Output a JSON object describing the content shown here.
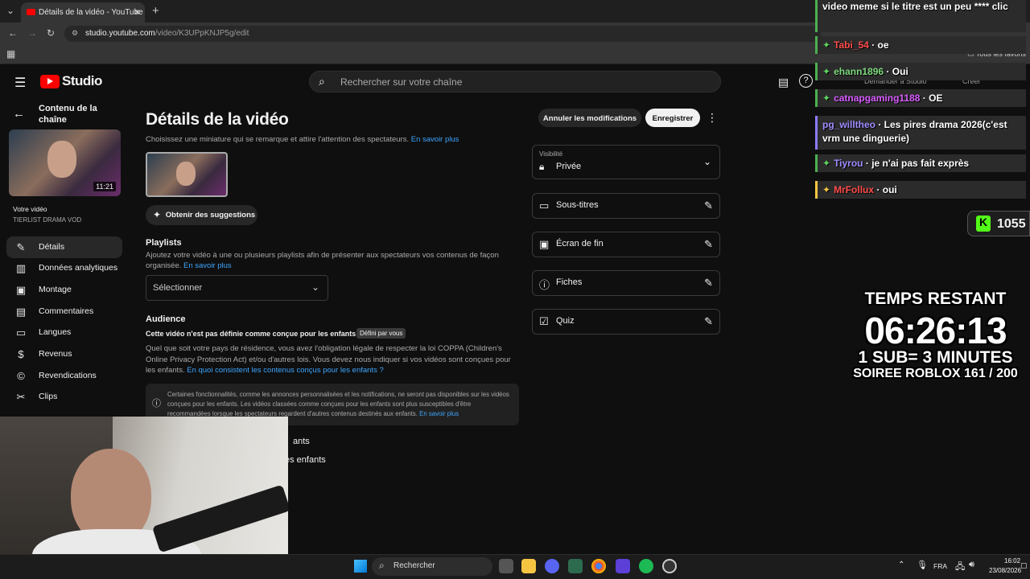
{
  "browser": {
    "tab_title": "Détails de la vidéo - YouTube Studio",
    "url_host": "studio.youtube.com",
    "url_path": "/video/K3UPpKNJP5g/edit",
    "bookmarks_label": "Tous les favoris"
  },
  "header": {
    "logo_text": "Studio",
    "search_placeholder": "Rechercher sur votre chaîne",
    "studio_ask": "Demander à Studio",
    "create": "Créer"
  },
  "sidebar": {
    "back_label": "Contenu de la chaîne",
    "video_duration": "11:21",
    "your_video": "Votre vidéo",
    "video_name": "TIERLIST DRAMA VOD",
    "items": [
      {
        "label": "Détails",
        "icon": "pencil-icon"
      },
      {
        "label": "Données analytiques",
        "icon": "analytics-icon"
      },
      {
        "label": "Montage",
        "icon": "editor-icon"
      },
      {
        "label": "Commentaires",
        "icon": "comments-icon"
      },
      {
        "label": "Langues",
        "icon": "subtitles-icon"
      },
      {
        "label": "Revenus",
        "icon": "dollar-icon"
      },
      {
        "label": "Revendications",
        "icon": "copyright-icon"
      },
      {
        "label": "Clips",
        "icon": "scissors-icon"
      }
    ]
  },
  "main": {
    "title": "Détails de la vidéo",
    "thumbnail_help": "Choisissez une miniature qui se remarque et attire l'attention des spectateurs.",
    "learn_more": "En savoir plus",
    "suggestions_button": "Obtenir des suggestions",
    "cancel_button": "Annuler les modifications",
    "save_button": "Enregistrer",
    "playlists": {
      "heading": "Playlists",
      "help": "Ajoutez votre vidéo à une ou plusieurs playlists afin de présenter aux spectateurs vos contenus de façon organisée.",
      "select_label": "Sélectionner"
    },
    "audience": {
      "heading": "Audience",
      "status": "Cette vidéo n'est pas définie comme conçue pour les enfants",
      "badge": "Défini par vous",
      "help": "Quel que soit votre pays de résidence, vous avez l'obligation légale de respecter la loi COPPA (Children's Online Privacy Protection Act) et/ou d'autres lois. Vous devez nous indiquer si vos vidéos sont conçues pour les enfants.",
      "help_link": "En quoi consistent les contenus conçus pour les enfants ?",
      "info": "Certaines fonctionnalités, comme les annonces personnalisées et les notifications, ne seront pas disponibles sur les vidéos conçues pour les enfants. Les vidéos classées comme conçues pour les enfants sont plus susceptibles d'être recommandées lorsque les spectateurs regardent d'autres contenus destinés aux enfants.",
      "info_link": "En savoir plus",
      "opt1_partial": "ants",
      "opt2_partial": "es enfants"
    },
    "visibility": {
      "label": "Visibilité",
      "value": "Privée"
    },
    "cards": [
      {
        "label": "Sous-titres",
        "icon": "subtitles-icon"
      },
      {
        "label": "Écran de fin",
        "icon": "end-screen-icon"
      },
      {
        "label": "Fiches",
        "icon": "info-icon"
      },
      {
        "label": "Quiz",
        "icon": "quiz-icon"
      }
    ]
  },
  "chat": {
    "lines": [
      {
        "user": "",
        "user_color": "#ffffff",
        "message": "video meme si le titre est un peu **** clic"
      },
      {
        "user": "Tabi_54",
        "user_color": "#ff4d4d",
        "message": "oe"
      },
      {
        "user": "ehann1896",
        "user_color": "#7dd87d",
        "message": "Oui"
      },
      {
        "user": "catnapgaming1188",
        "user_color": "#d85cff",
        "message": "OE"
      },
      {
        "user": "pg_willtheo",
        "user_color": "#9f8cff",
        "message": "Les pires drama 2026(c'est vrm une dinguerie)"
      },
      {
        "user": "Tiyrou",
        "user_color": "#9f8cff",
        "message": "je n'ai pas fait exprès"
      },
      {
        "user": "MrFollux",
        "user_color": "#ff4d4d",
        "message": "oui"
      }
    ],
    "kick_count": "1055"
  },
  "overlay": {
    "timer_label": "TEMPS RESTANT",
    "timer": "06:26:13",
    "rule": "1 SUB= 3 MINUTES",
    "goal": "SOIREE ROBLOX 161 / 200"
  },
  "taskbar": {
    "search": "Rechercher",
    "lang": "FRA",
    "time": "16:02",
    "date": "23/08/2026"
  }
}
